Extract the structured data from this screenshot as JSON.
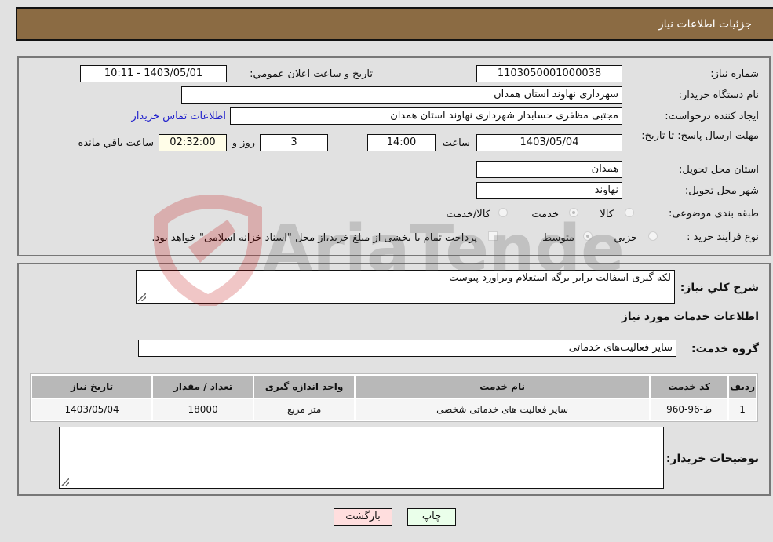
{
  "header": {
    "title": "جزئیات اطلاعات نیاز"
  },
  "fields": {
    "need_number_label": "شماره نیاز:",
    "need_number": "1103050001000038",
    "announce_label": "تاريخ و ساعت اعلان عمومي:",
    "announce_value": "1403/05/01 - 10:11",
    "buyer_org_label": "نام دستگاه خریدار:",
    "buyer_org": "شهرداری نهاوند استان همدان",
    "creator_label": "ایجاد کننده درخواست:",
    "creator": "مجتبی مظفری حسابدار شهرداری نهاوند استان همدان",
    "contact_link": "اطلاعات تماس خریدار",
    "deadline_label": "مهلت ارسال پاسخ: تا تاریخ:",
    "deadline_date": "1403/05/04",
    "time_label": "ساعت",
    "deadline_time": "14:00",
    "days_value": "3",
    "days_label": "روز و",
    "remaining_time": "02:32:00",
    "remaining_label": "ساعت باقي مانده",
    "province_label": "استان محل تحویل:",
    "province": "همدان",
    "city_label": "شهر محل تحویل:",
    "city": "نهاوند",
    "category_label": "طبقه بندی موضوعی:",
    "category_options": [
      "کالا",
      "خدمت",
      "کالا/خدمت"
    ],
    "category_selected": "خدمت",
    "process_label": "نوع فرآیند خرید :",
    "process_options": [
      "جزيي",
      "متوسط"
    ],
    "process_selected": "متوسط",
    "treasury_note": "پرداخت تمام یا بخشی از مبلغ خرید،از محل \"اسناد خزانه اسلامی\" خواهد بود."
  },
  "description": {
    "label": "شرح كلي نياز:",
    "value": "لکه گیری اسفالت برابر برگه استعلام وبراورد پیوست"
  },
  "services": {
    "section_title": "اطلاعات خدمات مورد نياز",
    "group_label": "گروه خدمت:",
    "group_value": "سایر فعالیت‌های خدماتی",
    "columns": [
      "رديف",
      "کد خدمت",
      "نام خدمت",
      "واحد اندازه گیری",
      "تعداد / مقدار",
      "تاريخ نياز"
    ],
    "rows": [
      [
        "1",
        "ط-96-960",
        "سایر فعالیت های خدماتی شخصی",
        "متر مربع",
        "18000",
        "1403/05/04"
      ]
    ]
  },
  "buyer_notes": {
    "label": "توضيحات خريدار:",
    "value": ""
  },
  "buttons": {
    "print": "چاپ",
    "back": "بازگشت"
  },
  "watermark": {
    "text": "AriaTender.neT"
  }
}
